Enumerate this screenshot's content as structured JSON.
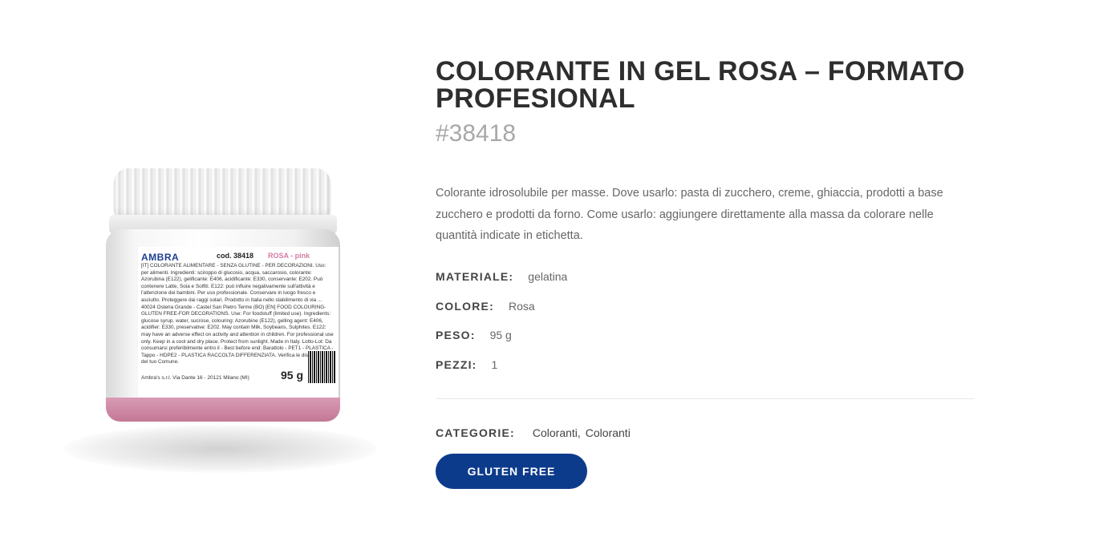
{
  "product": {
    "title": "COLORANTE IN GEL ROSA – FORMATO PROFESIONAL",
    "sku": "#38418",
    "description": "Colorante idrosolubile per masse. Dove usarlo: pasta di zucchero, creme, ghiaccia, prodotti a base zucchero e prodotti da forno. Come usarlo: aggiungere direttamente alla massa da colorare nelle quantità indicate in etichetta.",
    "attributes": [
      {
        "key": "MATERIALE:",
        "value": "gelatina"
      },
      {
        "key": "COLORE:",
        "value": "Rosa"
      },
      {
        "key": "PESO:",
        "value": "95 g"
      },
      {
        "key": "PEZZI:",
        "value": "1"
      }
    ],
    "categories_label": "CATEGORIE:",
    "categories": [
      "Coloranti",
      "Coloranti"
    ],
    "categories_separator": ",",
    "badge_label": "GLUTEN FREE",
    "badge_color": "#0d3b8c"
  },
  "jar_label": {
    "brand": "AMBRA",
    "code": "cod. 38418",
    "color_name": "ROSA - pink",
    "text": "[IT] COLORANTE ALIMENTARE - SENZA GLUTINE - PER DECORAZIONI. Uso: per alimenti. Ingredienti: sciroppo di glucosio, acqua, saccarosio, colorante: Azorubina (E122), gelificante: E406, acidificante: E330, conservante: E202. Può contenere Latte, Soia e Solfiti. E122: può influire negativamente sull'attività e l'attenzione dei bambini. Per uso professionale. Conservare in luogo fresco e asciutto. Proteggere dai raggi solari. Prodotto in Italia nello stabilimento di via ... 40024 Osteria Grande - Castel San Pietro Terme (BO) [EN] FOOD COLOURING-GLUTEN FREE-FOR DECORATIONS. Use: For foodstuff (limited use). Ingredients: glucose syrup, water, sucrose, colouring: Azorubine (E122), gelling agent: E406, acidifier: E330, preservative: E202. May contain Milk, Soybeans, Sulphites. E122: may have an adverse effect on activity and attention in children. For professional use only. Keep in a cool and dry place. Protect from sunlight. Made in Italy. Lotto-Lot: Da consumarsi preferibilmente entro il - Best before end: Barattolo - PET1 - PLASTICA - Tappo - HDPE2 - PLASTICA RACCOLTA DIFFERENZIATA. Verifica le disposizioni del tuo Comune.",
    "address": "Ambra's s.r.l. Via Dante 16 - 20121 Milano (MI)",
    "weight": "95 g"
  }
}
